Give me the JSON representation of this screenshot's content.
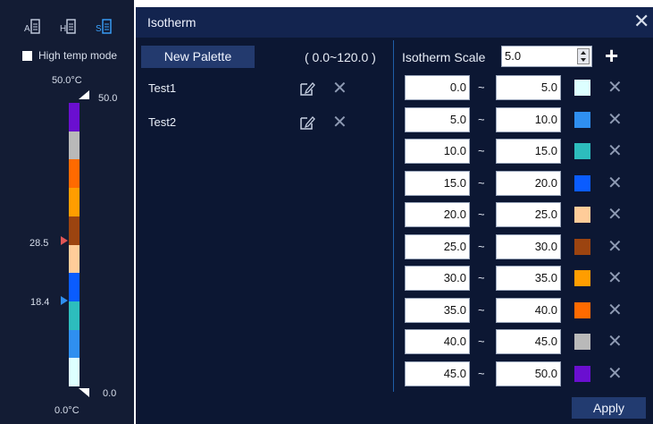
{
  "left_panel": {
    "mode_icons": [
      "A-list-icon",
      "H-list-icon",
      "S-list-icon"
    ],
    "high_temp_mode_label": "High temp mode",
    "top_temp_label": "50.0°C",
    "bottom_temp_label": "0.0°C",
    "scale_top_value": "50.0",
    "scale_bottom_value": "0.0",
    "marker_high_value": "28.5",
    "marker_low_value": "18.4",
    "marker_high_color": "#e05555",
    "marker_low_color": "#2f8ff0",
    "colorbar_colors_top_to_bottom": [
      "#6a0fd0",
      "#b9b9b9",
      "#ff6a00",
      "#ff9d00",
      "#9c4410",
      "#ffcc99",
      "#0a5cff",
      "#2dbdbd",
      "#2f8ff0",
      "#ddffff"
    ]
  },
  "dialog": {
    "title": "Isotherm",
    "close_icon": "close-icon",
    "new_palette_label": "New Palette",
    "range_label": "( 0.0~120.0 )",
    "palettes": [
      {
        "name": "Test1"
      },
      {
        "name": "Test2"
      }
    ],
    "isotherm_scale_label": "Isotherm Scale",
    "isotherm_scale_value": "5.0",
    "add_icon": "plus-icon",
    "range_separator": "~",
    "rows": [
      {
        "from": "0.0",
        "to": "5.0",
        "color": "#ddffff"
      },
      {
        "from": "5.0",
        "to": "10.0",
        "color": "#2f8ff0"
      },
      {
        "from": "10.0",
        "to": "15.0",
        "color": "#2dbdbd"
      },
      {
        "from": "15.0",
        "to": "20.0",
        "color": "#0a5cff"
      },
      {
        "from": "20.0",
        "to": "25.0",
        "color": "#ffcc99"
      },
      {
        "from": "25.0",
        "to": "30.0",
        "color": "#9c4410"
      },
      {
        "from": "30.0",
        "to": "35.0",
        "color": "#ff9d00"
      },
      {
        "from": "35.0",
        "to": "40.0",
        "color": "#ff6a00"
      },
      {
        "from": "40.0",
        "to": "45.0",
        "color": "#b9b9b9"
      },
      {
        "from": "45.0",
        "to": "50.0",
        "color": "#6a0fd0"
      }
    ],
    "apply_label": "Apply"
  }
}
